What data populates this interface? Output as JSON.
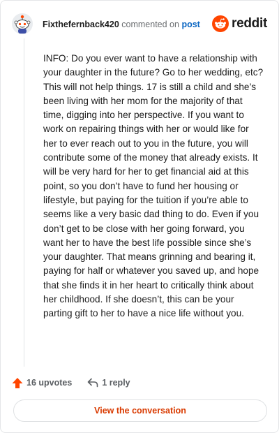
{
  "header": {
    "username": "Fixthefernback420",
    "action_text": "commented on",
    "post_link": "post",
    "brand_name": "reddit"
  },
  "icons": {
    "avatar": "snoo-avatar-icon",
    "brand": "reddit-logo-icon",
    "upvote": "upvote-arrow-icon",
    "reply": "reply-arrow-icon"
  },
  "colors": {
    "upvote": "#ff4500",
    "cta_text": "#d93a00",
    "link": "#0a66c2",
    "brand_orange": "#ff4500"
  },
  "comment": {
    "text": "INFO: Do you ever want to have a relationship with your daughter in the future? Go to her wedding, etc? This will not help things. 17 is still a child and she’s been living with her mom for the majority of that time, digging into her perspective. If you want to work on repairing things with her or would like for her to ever reach out to you in the future, you will contribute some of the money that already exists. It will be very hard for her to get financial aid at this point, so you don’t have to fund her housing or lifestyle, but paying for the tuition if you’re able to seems like a very basic dad thing to do. Even if you don’t get to be close with her going forward, you want her to have the best life possible since she’s your daughter. That means grinning and bearing it, paying for half or whatever you saved up, and hope that she finds it in her heart to critically think about her childhood. If she doesn’t, this can be your parting gift to her to have a nice life without you."
  },
  "footer": {
    "upvotes": "16 upvotes",
    "replies": "1 reply",
    "view_button": "View the conversation"
  }
}
